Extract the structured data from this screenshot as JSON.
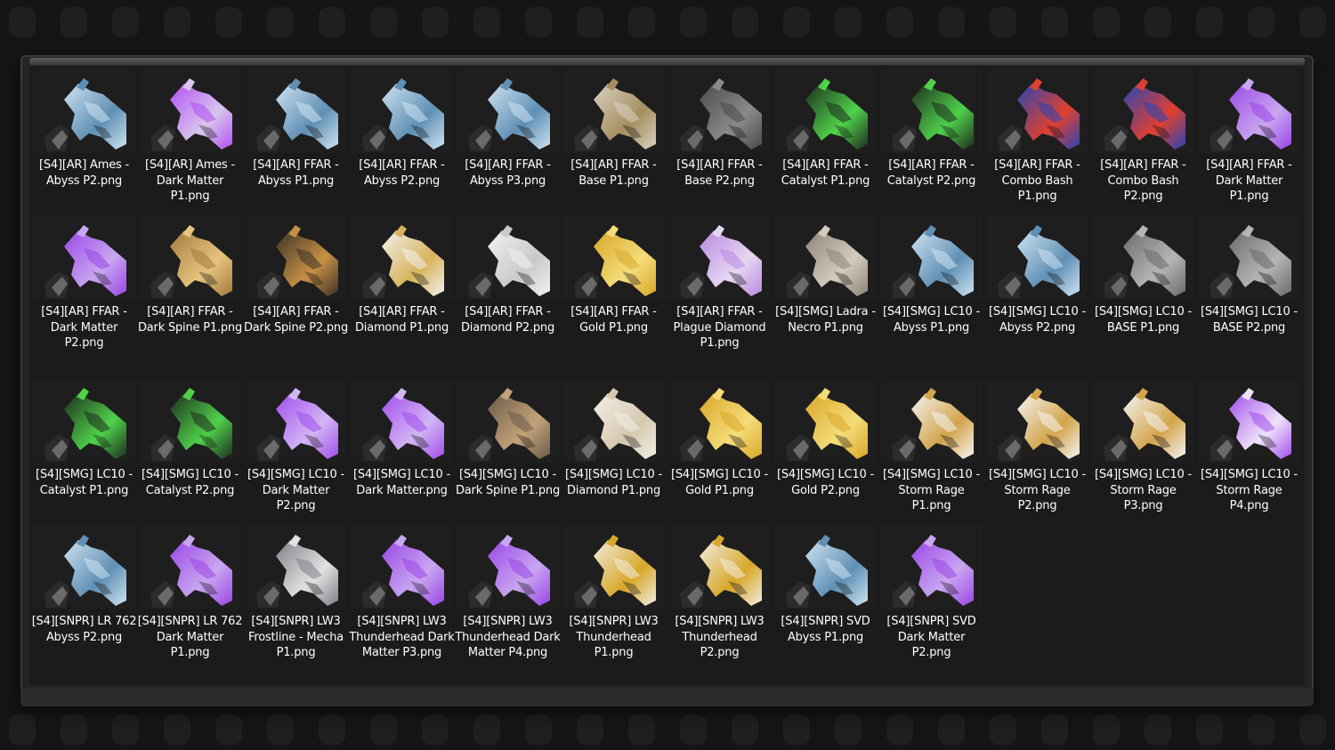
{
  "files": [
    {
      "name": "[S4][AR] Ames - Abyss P2.png",
      "colors": [
        "#cfe4f2",
        "#5f8fb4"
      ]
    },
    {
      "name": "[S4][AR] Ames - Dark Matter P1.png",
      "colors": [
        "#b14ff0",
        "#d8c6ee"
      ]
    },
    {
      "name": "[S4][AR] FFAR - Abyss P1.png",
      "colors": [
        "#cfe4f2",
        "#5f8fb4"
      ]
    },
    {
      "name": "[S4][AR] FFAR - Abyss P2.png",
      "colors": [
        "#cfe4f2",
        "#5f8fb4"
      ]
    },
    {
      "name": "[S4][AR] FFAR - Abyss P3.png",
      "colors": [
        "#cfe4f2",
        "#5f8fb4"
      ]
    },
    {
      "name": "[S4][AR] FFAR - Base P1.png",
      "colors": [
        "#d9d3c4",
        "#a58d5f"
      ]
    },
    {
      "name": "[S4][AR] FFAR - Base P2.png",
      "colors": [
        "#4a4a4a",
        "#8a8a8a"
      ]
    },
    {
      "name": "[S4][AR] FFAR - Catalyst P1.png",
      "colors": [
        "#1e2b1e",
        "#4fd24a"
      ]
    },
    {
      "name": "[S4][AR] FFAR - Catalyst P2.png",
      "colors": [
        "#1e2b1e",
        "#4fd24a"
      ]
    },
    {
      "name": "[S4][AR] FFAR - Combo Bash P1.png",
      "colors": [
        "#2846b8",
        "#e0402e"
      ]
    },
    {
      "name": "[S4][AR] FFAR - Combo Bash P2.png",
      "colors": [
        "#2846b8",
        "#e0402e"
      ]
    },
    {
      "name": "[S4][AR] FFAR - Dark Matter P1.png",
      "colors": [
        "#9a46e6",
        "#c8a6f0"
      ]
    },
    {
      "name": "[S4][AR] FFAR - Dark Matter P2.png",
      "colors": [
        "#9a46e6",
        "#c8a6f0"
      ]
    },
    {
      "name": "[S4][AR] FFAR - Dark Spine P1.png",
      "colors": [
        "#a27a3e",
        "#e7c37e"
      ]
    },
    {
      "name": "[S4][AR] FFAR - Dark Spine P2.png",
      "colors": [
        "#3c3228",
        "#c79045"
      ]
    },
    {
      "name": "[S4][AR] FFAR - Diamond P1.png",
      "colors": [
        "#f2f2f2",
        "#d7b35a"
      ]
    },
    {
      "name": "[S4][AR] FFAR - Diamond P2.png",
      "colors": [
        "#f2f2f2",
        "#c9c9c9"
      ]
    },
    {
      "name": "[S4][AR] FFAR - Gold P1.png",
      "colors": [
        "#d8a728",
        "#f4dc7a"
      ]
    },
    {
      "name": "[S4][AR] FFAR - Plague Diamond P1.png",
      "colors": [
        "#b888e0",
        "#e6d6f2"
      ]
    },
    {
      "name": "[S4][SMG] Ladra - Necro P1.png",
      "colors": [
        "#8d8478",
        "#d3cbbd"
      ]
    },
    {
      "name": "[S4][SMG] LC10 - Abyss P1.png",
      "colors": [
        "#cfe4f2",
        "#5f8fb4"
      ]
    },
    {
      "name": "[S4][SMG] LC10 - Abyss P2.png",
      "colors": [
        "#cfe4f2",
        "#5f8fb4"
      ]
    },
    {
      "name": "[S4][SMG] LC10 - BASE P1.png",
      "colors": [
        "#6a6a6a",
        "#b5b5b5"
      ]
    },
    {
      "name": "[S4][SMG] LC10 - BASE P2.png",
      "colors": [
        "#6a6a6a",
        "#b5b5b5"
      ]
    },
    {
      "name": "[S4][SMG] LC10 - Catalyst P1.png",
      "colors": [
        "#1e2b1e",
        "#4fd24a"
      ]
    },
    {
      "name": "[S4][SMG] LC10 - Catalyst P2.png",
      "colors": [
        "#1e2b1e",
        "#4fd24a"
      ]
    },
    {
      "name": "[S4][SMG] LC10 - Dark Matter P2.png",
      "colors": [
        "#a24cec",
        "#d2b6f4"
      ]
    },
    {
      "name": "[S4][SMG] LC10 - Dark Matter.png",
      "colors": [
        "#a24cec",
        "#d2b6f4"
      ]
    },
    {
      "name": "[S4][SMG] LC10 - Dark Spine P1.png",
      "colors": [
        "#6a5a48",
        "#c4a27a"
      ]
    },
    {
      "name": "[S4][SMG] LC10 - Diamond P1.png",
      "colors": [
        "#f2efe8",
        "#d6c8ae"
      ]
    },
    {
      "name": "[S4][SMG] LC10 - Gold P1.png",
      "colors": [
        "#d8a728",
        "#f4dc7a"
      ]
    },
    {
      "name": "[S4][SMG] LC10 - Gold P2.png",
      "colors": [
        "#d8a728",
        "#f4dc7a"
      ]
    },
    {
      "name": "[S4][SMG] LC10 - Storm Rage P1.png",
      "colors": [
        "#f4f4f4",
        "#d3a44a"
      ]
    },
    {
      "name": "[S4][SMG] LC10 - Storm Rage P2.png",
      "colors": [
        "#f4f4f4",
        "#d3a44a"
      ]
    },
    {
      "name": "[S4][SMG] LC10 - Storm Rage P3.png",
      "colors": [
        "#f4f4f4",
        "#d3a44a"
      ]
    },
    {
      "name": "[S4][SMG] LC10 - Storm Rage P4.png",
      "colors": [
        "#a24cec",
        "#efe4fa"
      ]
    },
    {
      "name": "[S4][SNPR] LR 762 Abyss P2.png",
      "colors": [
        "#cfe4f2",
        "#5f8fb4"
      ]
    },
    {
      "name": "[S4][SNPR] LR 762 Dark Matter P1.png",
      "colors": [
        "#9a46e6",
        "#c8a6f0"
      ]
    },
    {
      "name": "[S4][SNPR] LW3 Frostline - Mecha P1.png",
      "colors": [
        "#7d8087",
        "#e2e2e2"
      ]
    },
    {
      "name": "[S4][SNPR] LW3 Thunderhead Dark Matter P3.png",
      "colors": [
        "#9a46e6",
        "#c8a6f0"
      ]
    },
    {
      "name": "[S4][SNPR] LW3 Thunderhead Dark Matter P4.png",
      "colors": [
        "#9a46e6",
        "#c8a6f0"
      ]
    },
    {
      "name": "[S4][SNPR] LW3 Thunderhead P1.png",
      "colors": [
        "#f2ede2",
        "#d8a728"
      ]
    },
    {
      "name": "[S4][SNPR] LW3 Thunderhead P2.png",
      "colors": [
        "#f2ede2",
        "#d8a728"
      ]
    },
    {
      "name": "[S4][SNPR] SVD Abyss P1.png",
      "colors": [
        "#cfe4f2",
        "#5f8fb4"
      ]
    },
    {
      "name": "[S4][SNPR] SVD Dark Matter P2.png",
      "colors": [
        "#9a46e6",
        "#c8a6f0"
      ]
    }
  ]
}
